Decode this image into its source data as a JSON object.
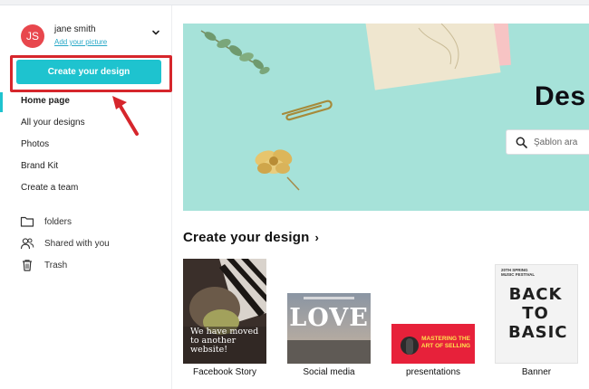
{
  "user": {
    "initials": "JS",
    "name": "jane smith",
    "add_picture": "Add your picture"
  },
  "sidebar": {
    "create_button": "Create your design",
    "nav": [
      {
        "label": "Home page",
        "active": true
      },
      {
        "label": "All your designs"
      },
      {
        "label": "Photos"
      },
      {
        "label": "Brand Kit"
      },
      {
        "label": "Create a team"
      }
    ],
    "utilities": [
      {
        "label": "folders",
        "icon": "folder-icon"
      },
      {
        "label": "Shared with you",
        "icon": "shared-users-icon"
      },
      {
        "label": "Trash",
        "icon": "trash-icon"
      }
    ]
  },
  "hero": {
    "title": "Des",
    "search_placeholder": "Şablon ara"
  },
  "section": {
    "title": "Create your design"
  },
  "cards": [
    {
      "label": "Facebook Story",
      "text": "We have moved to another website!"
    },
    {
      "label": "Social media",
      "text": "LOVE"
    },
    {
      "label": "presentations",
      "text_line1": "MASTERING THE",
      "text_line2": "ART OF SELLING"
    },
    {
      "label": "Banner",
      "text": "BACK TO BASIC",
      "small_top": "20TH SPRING",
      "small_top2": "MUSIC FESTIVAL"
    }
  ],
  "colors": {
    "accent": "#1ec3cf",
    "highlight": "#d6262c",
    "avatar": "#e8474d",
    "hero_bg": "#a6e2d9",
    "link": "#27a8c7"
  }
}
